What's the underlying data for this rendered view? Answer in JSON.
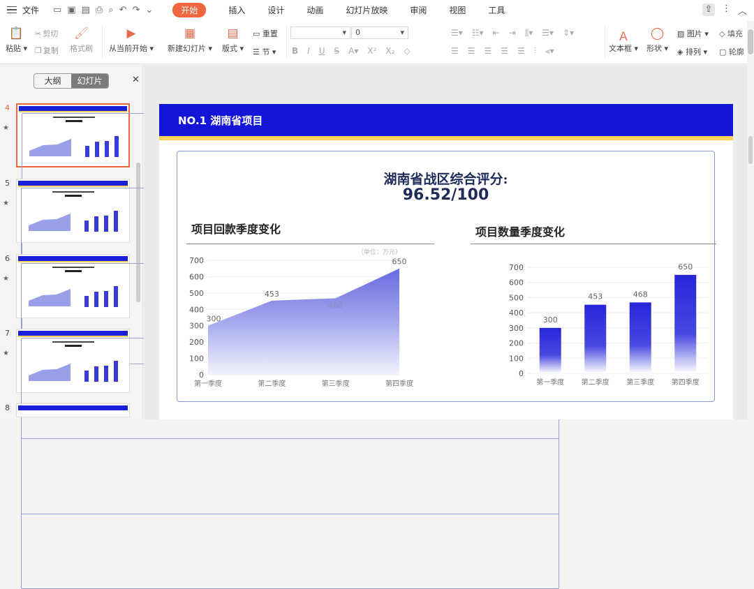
{
  "menubar": {
    "file": "文件",
    "tabs": [
      "开始",
      "插入",
      "设计",
      "动画",
      "幻灯片放映",
      "审阅",
      "视图",
      "工具"
    ]
  },
  "ribbon": {
    "paste": "粘贴",
    "cut": "剪切",
    "copy": "复制",
    "format_painter": "格式刷",
    "from_current": "从当前开始",
    "new_slide": "新建幻灯片",
    "layout": "版式",
    "reset": "重置",
    "section": "节",
    "font_size": "0",
    "textbox": "文本框",
    "shape": "形状",
    "picture": "图片",
    "arrange": "排列",
    "fill": "填充",
    "outline": "轮廓"
  },
  "panel": {
    "outline_tab": "大纲",
    "slides_tab": "幻灯片",
    "thumbs": [
      {
        "num": "4",
        "selected": true
      },
      {
        "num": "5",
        "selected": false
      },
      {
        "num": "6",
        "selected": false
      },
      {
        "num": "7",
        "selected": false
      }
    ],
    "next_num": "8"
  },
  "slide": {
    "header": "NO.1 湖南省项目",
    "title_line1": "湖南省战区综合评分:",
    "title_line2": "96.52/100",
    "left_title": "项目回款季度变化",
    "right_title": "项目数量季度变化",
    "unit_label": "（单位：万元）"
  },
  "colors": {
    "header_blue": "#1515d8",
    "gold": "#f7d35b",
    "accent_orange": "#f0663f",
    "series_blue": "#2626d9"
  },
  "chart_data": [
    {
      "type": "area",
      "title": "项目回款季度变化",
      "categories": [
        "第一季度",
        "第二季度",
        "第三季度",
        "第四季度"
      ],
      "values": [
        300,
        453,
        468,
        650
      ],
      "ylim": [
        0,
        700
      ],
      "yticks": [
        0,
        100,
        200,
        300,
        400,
        500,
        600,
        700
      ],
      "grid": true
    },
    {
      "type": "bar",
      "title": "项目数量季度变化",
      "categories": [
        "第一季度",
        "第二季度",
        "第三季度",
        "第四季度"
      ],
      "values": [
        300,
        453,
        468,
        650
      ],
      "ylim": [
        0,
        700
      ],
      "yticks": [
        0,
        100,
        200,
        300,
        400,
        500,
        600,
        700
      ],
      "grid": true
    }
  ]
}
